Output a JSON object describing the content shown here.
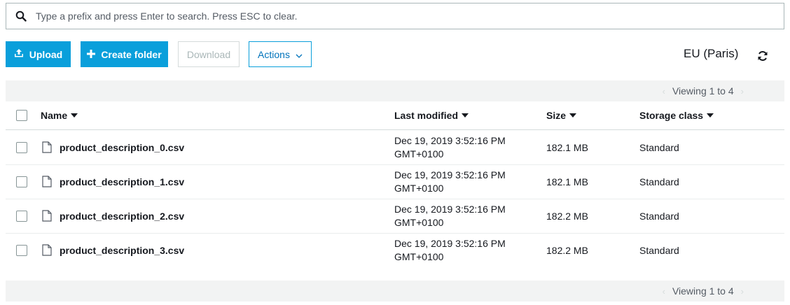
{
  "search": {
    "placeholder": "Type a prefix and press Enter to search. Press ESC to clear."
  },
  "toolbar": {
    "upload_label": "Upload",
    "create_folder_label": "Create folder",
    "download_label": "Download",
    "actions_label": "Actions",
    "region": "EU (Paris)"
  },
  "pagination": {
    "viewing_text": "Viewing 1 to 4"
  },
  "table": {
    "columns": {
      "name": "Name",
      "last_modified": "Last modified",
      "size": "Size",
      "storage_class": "Storage class"
    },
    "rows": [
      {
        "name": "product_description_0.csv",
        "date_line1": "Dec 19, 2019 3:52:16 PM",
        "date_line2": "GMT+0100",
        "size": "182.1 MB",
        "storage_class": "Standard"
      },
      {
        "name": "product_description_1.csv",
        "date_line1": "Dec 19, 2019 3:52:16 PM",
        "date_line2": "GMT+0100",
        "size": "182.1 MB",
        "storage_class": "Standard"
      },
      {
        "name": "product_description_2.csv",
        "date_line1": "Dec 19, 2019 3:52:16 PM",
        "date_line2": "GMT+0100",
        "size": "182.2 MB",
        "storage_class": "Standard"
      },
      {
        "name": "product_description_3.csv",
        "date_line1": "Dec 19, 2019 3:52:16 PM",
        "date_line2": "GMT+0100",
        "size": "182.2 MB",
        "storage_class": "Standard"
      }
    ]
  },
  "colors": {
    "primary": "#0a9fdb",
    "link": "#0073bb",
    "bar": "#f2f3f3"
  }
}
